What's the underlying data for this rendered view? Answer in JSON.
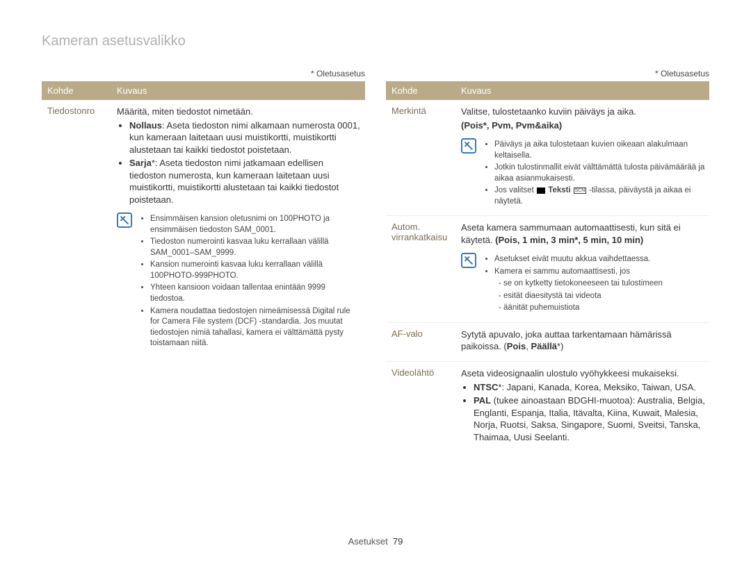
{
  "page_title": "Kameran asetusvalikko",
  "default_label": "* Oletusasetus",
  "headers": {
    "kohde": "Kohde",
    "kuvaus": "Kuvaus"
  },
  "footer": {
    "section": "Asetukset",
    "page": "79"
  },
  "left": {
    "tiedostonro": {
      "label": "Tiedostonro",
      "intro": "Määritä, miten tiedostot nimetään.",
      "nollaus_label": "Nollaus",
      "nollaus_text": ": Aseta tiedoston nimi alkamaan numerosta 0001, kun kameraan laitetaan uusi muistikortti, muistikortti alustetaan tai kaikki tiedostot poistetaan.",
      "sarja_label": "Sarja",
      "sarja_text": "*: Aseta tiedoston nimi jatkamaan edellisen tiedoston numerosta, kun kameraan laitetaan uusi muistikortti, muistikortti alustetaan tai kaikki tiedostot poistetaan.",
      "notes": {
        "a": "Ensimmäisen kansion oletusnimi on 100PHOTO ja ensimmäisen tiedoston SAM_0001.",
        "b": "Tiedoston numerointi kasvaa luku kerrallaan välillä SAM_0001–SAM_9999.",
        "c": "Kansion numerointi kasvaa luku kerrallaan välillä 100PHOTO-999PHOTO.",
        "d": "Yhteen kansioon voidaan tallentaa enintään 9999 tiedostoa.",
        "e": "Kamera noudattaa tiedostojen nimeämisessä Digital rule for Camera File system (DCF) -standardia. Jos muutat tiedostojen nimiä tahallasi, kamera ei välttämättä pysty toistamaan niitä."
      }
    }
  },
  "right": {
    "merkinta": {
      "label": "Merkintä",
      "intro": "Valitse, tulostetaanko kuviin päiväys ja aika.",
      "options": "(Pois*, Pvm, Pvm&aika)",
      "notes": {
        "a": "Päiväys ja aika tulostetaan kuvien oikeaan alakulmaan keltaisella.",
        "b": "Jotkin tulostinmallit eivät välttämättä tulosta päivämäärää ja aikaa asianmukaisesti.",
        "c_pre": "Jos valitset ",
        "c_bold": "Teksti",
        "c_post": " -tilassa, päiväystä ja aikaa ei näytetä."
      }
    },
    "autom": {
      "label": "Autom. virrankatkaisu",
      "intro": "Aseta kamera sammumaan automaattisesti, kun sitä ei käytetä. ",
      "options": "(Pois, 1 min, 3 min*, 5 min, 10 min)",
      "notes": {
        "a": "Asetukset eivät muutu akkua vaihdettaessa.",
        "b": "Kamera ei sammu automaattisesti, jos",
        "b1": "se on kytketty tietokoneeseen tai tulostimeen",
        "b2": "esität diaesitystä tai videota",
        "b3": "äänität puhemuistiota"
      }
    },
    "afvalo": {
      "label": "AF-valo",
      "text_pre": "Sytytä apuvalo, joka auttaa tarkentamaan hämärissä paikoissa. (",
      "opt_pois": "Pois",
      "sep": ", ",
      "opt_paalla": "Päällä",
      "text_post": "*)"
    },
    "videolahto": {
      "label": "Videolähtö",
      "intro": "Aseta videosignaalin ulostulo vyöhykkeesi mukaiseksi.",
      "ntsc_label": "NTSC",
      "ntsc_text": "*: Japani, Kanada, Korea, Meksiko, Taiwan, USA.",
      "pal_label": "PAL",
      "pal_paren": " (tukee ainoastaan BDGHI-muotoa): ",
      "pal_text": "Australia, Belgia, Englanti, Espanja, Italia, Itävalta, Kiina, Kuwait, Malesia, Norja, Ruotsi, Saksa, Singapore, Suomi, Sveitsi, Tanska, Thaimaa, Uusi Seelanti."
    }
  }
}
